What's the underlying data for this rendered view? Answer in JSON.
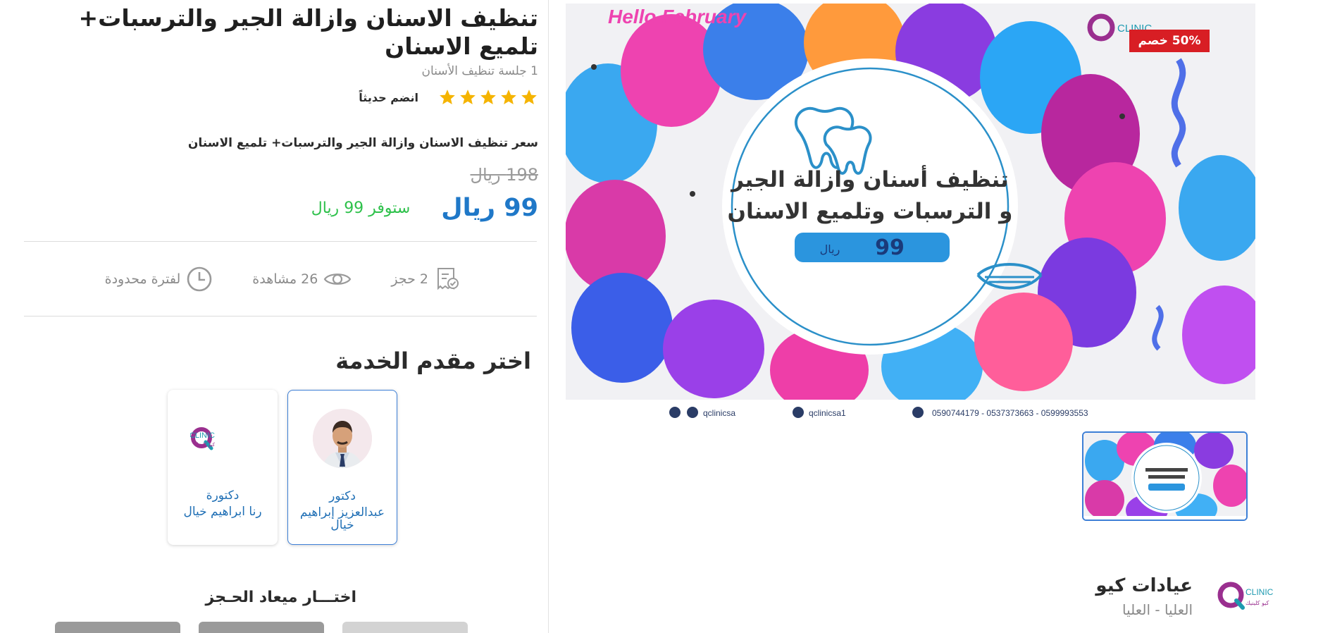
{
  "offer": {
    "title": "تنظيف الاسنان وازالة الجير والترسبات+ تلميع الاسنان",
    "subtitle": "1 جلسة تنظيف الأسنان",
    "rating": 5,
    "join_label": "انضم حديثاً",
    "price_title": "سعر تنظيف الاسنان وازالة الجير والترسبات+ تلميع الاسنان",
    "old_price": "198 ريال",
    "new_price": "99 ريال",
    "savings": "ستوفر 99 ريال",
    "discount_badge": "50% خصم"
  },
  "stats": {
    "bookings": "2 حجز",
    "views": "26 مشاهدة",
    "limited": "لفترة محدودة"
  },
  "providers": {
    "title": "اختر مقدم الخدمة",
    "items": [
      {
        "role": "دكتور",
        "name": "عبدالعزيز إبراهيم خيال",
        "selected": true
      },
      {
        "role": "دكتورة",
        "name": "رنا ابراهيم خيال",
        "selected": false
      }
    ]
  },
  "booking": {
    "title": "اختـــار ميعاد الحـجز"
  },
  "promo_image": {
    "header": "Hello February",
    "logo_text": "CLINIC",
    "logo_sub": "كيو كلينيك",
    "line1": "تنظيف أسنان وازالة الجير",
    "line2": "و الترسبات وتلميع الاسنان",
    "price_number": "99",
    "price_unit": "ريال",
    "social1": "qclinicsa",
    "social2": "qclinicsa1",
    "phones": "0590744179 - 0537373663 - 0599993553"
  },
  "clinic": {
    "name": "عيادات كيو",
    "location": "العليا - العليا",
    "logo_text": "CLINIC",
    "logo_sub": "كيو كلينيك"
  },
  "colors": {
    "price_blue": "#1f78c8",
    "save_green": "#2ec14b",
    "badge_red": "#d81e24",
    "star": "#f5b400",
    "clinic_teal": "#1e9ab0",
    "clinic_purple": "#9a2f8f"
  }
}
